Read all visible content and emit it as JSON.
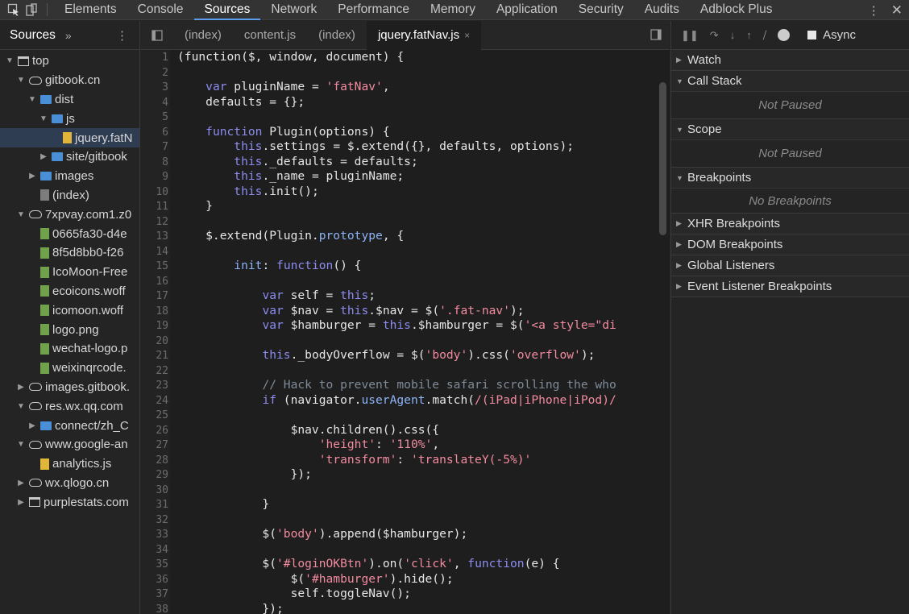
{
  "toolbar": {
    "tabs": [
      "Elements",
      "Console",
      "Sources",
      "Network",
      "Performance",
      "Memory",
      "Application",
      "Security",
      "Audits",
      "Adblock Plus"
    ],
    "active_tab": "Sources"
  },
  "navigator": {
    "tab": "Sources",
    "more": "»",
    "tree": [
      {
        "label": "top",
        "depth": 0,
        "icon": "frame-icon",
        "arrow": "open"
      },
      {
        "label": "gitbook.cn",
        "depth": 1,
        "icon": "cloud-icon",
        "arrow": "open"
      },
      {
        "label": "dist",
        "depth": 2,
        "icon": "folder-icon",
        "arrow": "open"
      },
      {
        "label": "js",
        "depth": 3,
        "icon": "folder-icon",
        "arrow": "open"
      },
      {
        "label": "jquery.fatN",
        "depth": 4,
        "icon": "js-file-icon",
        "arrow": "none",
        "selected": true
      },
      {
        "label": "site/gitbook",
        "depth": 3,
        "icon": "folder-icon",
        "arrow": "closed"
      },
      {
        "label": "images",
        "depth": 2,
        "icon": "folder-icon",
        "arrow": "closed"
      },
      {
        "label": "(index)",
        "depth": 2,
        "icon": "file-icon",
        "arrow": "none"
      },
      {
        "label": "7xpvay.com1.z0",
        "depth": 1,
        "icon": "cloud-icon",
        "arrow": "open"
      },
      {
        "label": "0665fa30-d4e",
        "depth": 2,
        "icon": "resource-file-icon",
        "arrow": "none"
      },
      {
        "label": "8f5d8bb0-f26",
        "depth": 2,
        "icon": "resource-file-icon",
        "arrow": "none"
      },
      {
        "label": "IcoMoon-Free",
        "depth": 2,
        "icon": "resource-file-icon",
        "arrow": "none"
      },
      {
        "label": "ecoicons.woff",
        "depth": 2,
        "icon": "resource-file-icon",
        "arrow": "none"
      },
      {
        "label": "icomoon.woff",
        "depth": 2,
        "icon": "resource-file-icon",
        "arrow": "none"
      },
      {
        "label": "logo.png",
        "depth": 2,
        "icon": "resource-file-icon",
        "arrow": "none"
      },
      {
        "label": "wechat-logo.p",
        "depth": 2,
        "icon": "resource-file-icon",
        "arrow": "none"
      },
      {
        "label": "weixinqrcode.",
        "depth": 2,
        "icon": "resource-file-icon",
        "arrow": "none"
      },
      {
        "label": "images.gitbook.",
        "depth": 1,
        "icon": "cloud-icon",
        "arrow": "closed"
      },
      {
        "label": "res.wx.qq.com",
        "depth": 1,
        "icon": "cloud-icon",
        "arrow": "open"
      },
      {
        "label": "connect/zh_C",
        "depth": 2,
        "icon": "folder-icon",
        "arrow": "closed"
      },
      {
        "label": "www.google-an",
        "depth": 1,
        "icon": "cloud-icon",
        "arrow": "open"
      },
      {
        "label": "analytics.js",
        "depth": 2,
        "icon": "js-file-icon",
        "arrow": "none"
      },
      {
        "label": "wx.qlogo.cn",
        "depth": 1,
        "icon": "cloud-icon",
        "arrow": "closed"
      },
      {
        "label": "purplestats.com",
        "depth": 1,
        "icon": "frame-icon",
        "arrow": "closed"
      }
    ]
  },
  "editor": {
    "tabs": [
      {
        "label": "(index)",
        "active": false
      },
      {
        "label": "content.js",
        "active": false
      },
      {
        "label": "(index)",
        "active": false
      },
      {
        "label": "jquery.fatNav.js",
        "active": true
      }
    ],
    "lines": [
      {
        "n": "1",
        "t": [
          [
            "(function($, window, document) {",
            ""
          ]
        ]
      },
      {
        "n": "2",
        "t": []
      },
      {
        "n": "3",
        "t": [
          [
            "    ",
            ""
          ],
          [
            "var",
            "kw"
          ],
          [
            " pluginName = ",
            ""
          ],
          [
            "'fatNav'",
            "str"
          ],
          [
            ",",
            ""
          ]
        ]
      },
      {
        "n": "4",
        "t": [
          [
            "    defaults = {};",
            ""
          ]
        ]
      },
      {
        "n": "5",
        "t": []
      },
      {
        "n": "6",
        "t": [
          [
            "    ",
            ""
          ],
          [
            "function",
            "kw"
          ],
          [
            " Plugin(options) {",
            ""
          ]
        ]
      },
      {
        "n": "7",
        "t": [
          [
            "        ",
            ""
          ],
          [
            "this",
            "kw"
          ],
          [
            ".settings = $.extend({}, defaults, options);",
            ""
          ]
        ]
      },
      {
        "n": "8",
        "t": [
          [
            "        ",
            ""
          ],
          [
            "this",
            "kw"
          ],
          [
            "._defaults = defaults;",
            ""
          ]
        ]
      },
      {
        "n": "9",
        "t": [
          [
            "        ",
            ""
          ],
          [
            "this",
            "kw"
          ],
          [
            "._name = pluginName;",
            ""
          ]
        ]
      },
      {
        "n": "10",
        "t": [
          [
            "        ",
            ""
          ],
          [
            "this",
            "kw"
          ],
          [
            ".init();",
            ""
          ]
        ]
      },
      {
        "n": "11",
        "t": [
          [
            "    }",
            ""
          ]
        ]
      },
      {
        "n": "12",
        "t": []
      },
      {
        "n": "13",
        "t": [
          [
            "    $.extend(Plugin.",
            ""
          ],
          [
            "prototype",
            "prop"
          ],
          [
            ", {",
            ""
          ]
        ]
      },
      {
        "n": "14",
        "t": []
      },
      {
        "n": "15",
        "t": [
          [
            "        ",
            ""
          ],
          [
            "init",
            "prop"
          ],
          [
            ": ",
            ""
          ],
          [
            "function",
            "kw"
          ],
          [
            "() {",
            ""
          ]
        ]
      },
      {
        "n": "16",
        "t": []
      },
      {
        "n": "17",
        "t": [
          [
            "            ",
            ""
          ],
          [
            "var",
            "kw"
          ],
          [
            " self = ",
            ""
          ],
          [
            "this",
            "kw"
          ],
          [
            ";",
            ""
          ]
        ]
      },
      {
        "n": "18",
        "t": [
          [
            "            ",
            ""
          ],
          [
            "var",
            "kw"
          ],
          [
            " $nav = ",
            ""
          ],
          [
            "this",
            "kw"
          ],
          [
            ".$nav = $(",
            ""
          ],
          [
            "'.fat-nav'",
            "str"
          ],
          [
            ");",
            ""
          ]
        ]
      },
      {
        "n": "19",
        "t": [
          [
            "            ",
            ""
          ],
          [
            "var",
            "kw"
          ],
          [
            " $hamburger = ",
            ""
          ],
          [
            "this",
            "kw"
          ],
          [
            ".$hamburger = $(",
            ""
          ],
          [
            "'<a style=\"di",
            "str"
          ]
        ]
      },
      {
        "n": "20",
        "t": []
      },
      {
        "n": "21",
        "t": [
          [
            "            ",
            ""
          ],
          [
            "this",
            "kw"
          ],
          [
            "._bodyOverflow = $(",
            ""
          ],
          [
            "'body'",
            "str"
          ],
          [
            ").css(",
            ""
          ],
          [
            "'overflow'",
            "str"
          ],
          [
            ");",
            ""
          ]
        ]
      },
      {
        "n": "22",
        "t": []
      },
      {
        "n": "23",
        "t": [
          [
            "            ",
            ""
          ],
          [
            "// Hack to prevent mobile safari scrolling the who",
            "com"
          ]
        ]
      },
      {
        "n": "24",
        "t": [
          [
            "            ",
            ""
          ],
          [
            "if",
            "kw"
          ],
          [
            " (navigator.",
            ""
          ],
          [
            "userAgent",
            "prop"
          ],
          [
            ".match(",
            ""
          ],
          [
            "/(iPad|iPhone|iPod)/",
            "re"
          ]
        ]
      },
      {
        "n": "25",
        "t": []
      },
      {
        "n": "26",
        "t": [
          [
            "                $nav.children().css({",
            ""
          ]
        ]
      },
      {
        "n": "27",
        "t": [
          [
            "                    ",
            ""
          ],
          [
            "'height'",
            "str"
          ],
          [
            ": ",
            ""
          ],
          [
            "'110%'",
            "str"
          ],
          [
            ",",
            ""
          ]
        ]
      },
      {
        "n": "28",
        "t": [
          [
            "                    ",
            ""
          ],
          [
            "'transform'",
            "str"
          ],
          [
            ": ",
            ""
          ],
          [
            "'translateY(-5%)'",
            "str"
          ]
        ]
      },
      {
        "n": "29",
        "t": [
          [
            "                });",
            ""
          ]
        ]
      },
      {
        "n": "30",
        "t": []
      },
      {
        "n": "31",
        "t": [
          [
            "            }",
            ""
          ]
        ]
      },
      {
        "n": "32",
        "t": []
      },
      {
        "n": "33",
        "t": [
          [
            "            $(",
            ""
          ],
          [
            "'body'",
            "str"
          ],
          [
            ").append($hamburger);",
            ""
          ]
        ]
      },
      {
        "n": "34",
        "t": []
      },
      {
        "n": "35",
        "t": [
          [
            "            $(",
            ""
          ],
          [
            "'#loginOKBtn'",
            "str"
          ],
          [
            ").on(",
            ""
          ],
          [
            "'click'",
            "str"
          ],
          [
            ", ",
            ""
          ],
          [
            "function",
            "kw"
          ],
          [
            "(e) {",
            ""
          ]
        ]
      },
      {
        "n": "36",
        "t": [
          [
            "                $(",
            ""
          ],
          [
            "'#hamburger'",
            "str"
          ],
          [
            ").hide();",
            ""
          ]
        ]
      },
      {
        "n": "37",
        "t": [
          [
            "                self.toggleNav();",
            ""
          ]
        ]
      },
      {
        "n": "38",
        "t": [
          [
            "            });",
            ""
          ]
        ]
      }
    ]
  },
  "debugger": {
    "async_label": "Async",
    "sections": [
      {
        "title": "Watch",
        "open": false,
        "body": ""
      },
      {
        "title": "Call Stack",
        "open": true,
        "body": "Not Paused"
      },
      {
        "title": "Scope",
        "open": true,
        "body": "Not Paused"
      },
      {
        "title": "Breakpoints",
        "open": true,
        "body": "No Breakpoints"
      },
      {
        "title": "XHR Breakpoints",
        "open": false,
        "body": ""
      },
      {
        "title": "DOM Breakpoints",
        "open": false,
        "body": ""
      },
      {
        "title": "Global Listeners",
        "open": false,
        "body": ""
      },
      {
        "title": "Event Listener Breakpoints",
        "open": false,
        "body": ""
      }
    ]
  },
  "colors": {
    "accent": "#5d9cec",
    "keyword": "#8c8cf0",
    "string": "#f28b9f",
    "comment": "#7f8b99"
  }
}
